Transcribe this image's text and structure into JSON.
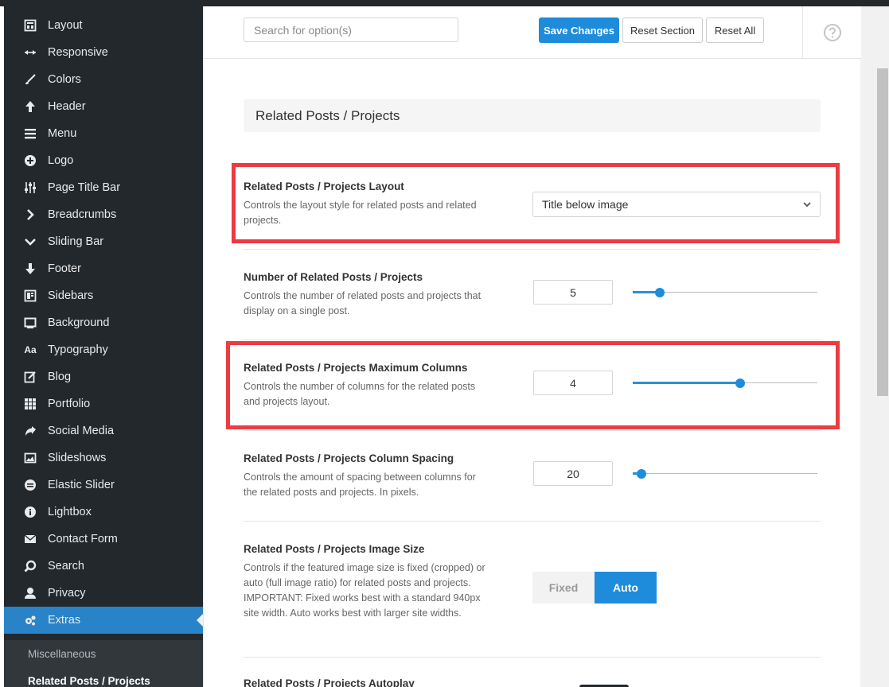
{
  "sidebar": {
    "items": [
      {
        "label": "Layout",
        "icon": "layout-icon"
      },
      {
        "label": "Responsive",
        "icon": "arrows-horizontal-icon"
      },
      {
        "label": "Colors",
        "icon": "brush-icon"
      },
      {
        "label": "Header",
        "icon": "arrow-up-icon"
      },
      {
        "label": "Menu",
        "icon": "hamburger-icon"
      },
      {
        "label": "Logo",
        "icon": "plus-circle-icon"
      },
      {
        "label": "Page Title Bar",
        "icon": "sliders-icon"
      },
      {
        "label": "Breadcrumbs",
        "icon": "chevron-right-icon"
      },
      {
        "label": "Sliding Bar",
        "icon": "chevron-down-icon"
      },
      {
        "label": "Footer",
        "icon": "arrow-down-icon"
      },
      {
        "label": "Sidebars",
        "icon": "sidebar-icon"
      },
      {
        "label": "Background",
        "icon": "monitor-icon"
      },
      {
        "label": "Typography",
        "icon": "typography-icon"
      },
      {
        "label": "Blog",
        "icon": "edit-icon"
      },
      {
        "label": "Portfolio",
        "icon": "grid-icon"
      },
      {
        "label": "Social Media",
        "icon": "share-icon"
      },
      {
        "label": "Slideshows",
        "icon": "image-icon"
      },
      {
        "label": "Elastic Slider",
        "icon": "circle-minus-icon"
      },
      {
        "label": "Lightbox",
        "icon": "info-icon"
      },
      {
        "label": "Contact Form",
        "icon": "envelope-icon"
      },
      {
        "label": "Search",
        "icon": "search-icon"
      },
      {
        "label": "Privacy",
        "icon": "user-icon"
      },
      {
        "label": "Extras",
        "icon": "gears-icon",
        "active": true
      }
    ],
    "subitems": [
      {
        "label": "Miscellaneous"
      },
      {
        "label": "Related Posts / Projects",
        "current": true
      }
    ]
  },
  "header": {
    "search_placeholder": "Search for option(s)",
    "save_label": "Save Changes",
    "reset_section_label": "Reset Section",
    "reset_all_label": "Reset All",
    "help_icon": "question-circle-icon"
  },
  "section": {
    "title": "Related Posts / Projects"
  },
  "fields": {
    "layout": {
      "label": "Related Posts / Projects Layout",
      "desc": "Controls the layout style for related posts and related projects.",
      "value": "Title below image"
    },
    "number": {
      "label": "Number of Related Posts / Projects",
      "desc": "Controls the number of related posts and projects that display on a single post.",
      "value": "5",
      "slider_fraction": 0.147
    },
    "columns": {
      "label": "Related Posts / Projects Maximum Columns",
      "desc": "Controls the number of columns for the related posts and projects layout.",
      "value": "4",
      "slider_fraction": 0.582
    },
    "spacing": {
      "label": "Related Posts / Projects Column Spacing",
      "desc": "Controls the amount of spacing between columns for the related posts and projects. In pixels.",
      "value": "20",
      "slider_fraction": 0.047
    },
    "image_size": {
      "label": "Related Posts / Projects Image Size",
      "desc": "Controls if the featured image size is fixed (cropped) or auto (full image ratio) for related posts and projects. IMPORTANT: Fixed works best with a standard 940px site width. Auto works best with larger site widths.",
      "options": [
        "Fixed",
        "Auto"
      ],
      "selected": "Auto"
    },
    "autoplay": {
      "label": "Related Posts / Projects Autoplay"
    }
  },
  "colors": {
    "accent": "#1e8cdb",
    "highlight": "#ec3c42",
    "sidebar_bg": "#23282d"
  }
}
